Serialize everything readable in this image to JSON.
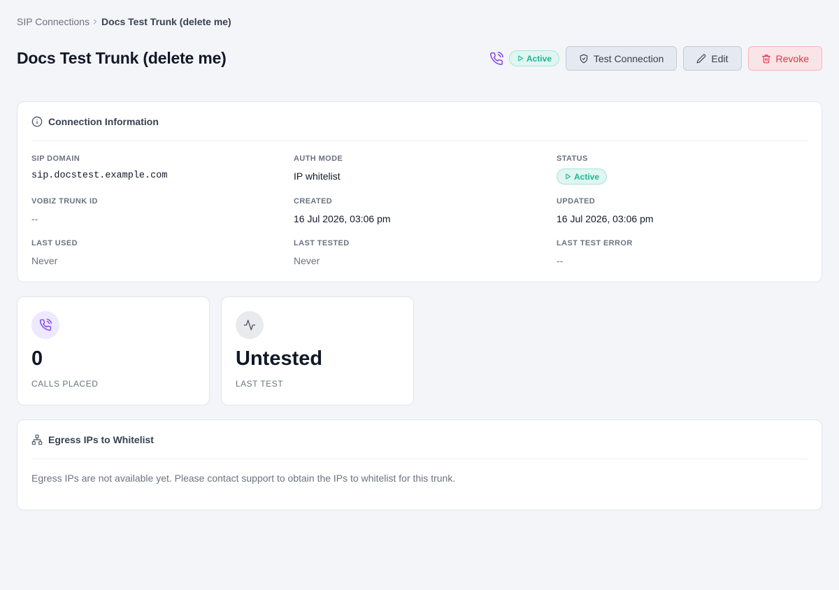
{
  "breadcrumb": {
    "parent": "SIP Connections",
    "current": "Docs Test Trunk (delete me)"
  },
  "page": {
    "title": "Docs Test Trunk (delete me)",
    "status_badge": "Active"
  },
  "actions": {
    "test_connection": "Test Connection",
    "edit": "Edit",
    "revoke": "Revoke"
  },
  "connection_info": {
    "title": "Connection Information",
    "sip_domain": {
      "label": "SIP Domain",
      "value": "sip.docstest.example.com"
    },
    "auth_mode": {
      "label": "Auth Mode",
      "value": "IP whitelist"
    },
    "status": {
      "label": "Status",
      "value": "Active"
    },
    "vobiz_trunk_id": {
      "label": "Vobiz Trunk ID",
      "value": "--"
    },
    "created": {
      "label": "Created",
      "value": "16 Jul 2026, 03:06 pm"
    },
    "updated": {
      "label": "Updated",
      "value": "16 Jul 2026, 03:06 pm"
    },
    "last_used": {
      "label": "Last Used",
      "value": "Never"
    },
    "last_tested": {
      "label": "Last Tested",
      "value": "Never"
    },
    "last_test_error": {
      "label": "Last Test Error",
      "value": "--"
    }
  },
  "stats": {
    "calls": {
      "value": "0",
      "label": "Calls Placed",
      "icon": "phone-outgoing-icon"
    },
    "last_test": {
      "value": "Untested",
      "label": "Last Test",
      "icon": "activity-icon"
    }
  },
  "egress": {
    "title": "Egress IPs to Whitelist",
    "message": "Egress IPs are not available yet. Please contact support to obtain the IPs to whitelist for this trunk."
  },
  "colors": {
    "background": "#f4f5f9",
    "accent_purple": "#7c3aed",
    "active_green": "#1fb496",
    "danger_red": "#dc3545"
  }
}
